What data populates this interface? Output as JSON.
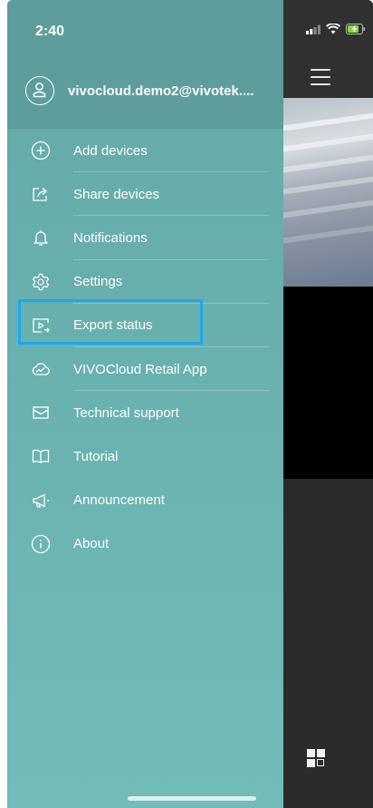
{
  "status_bar": {
    "time": "2:40"
  },
  "account": {
    "email": "vivocloud.demo2@vivotek...."
  },
  "menu": {
    "items": [
      {
        "label": "Add devices",
        "icon": "plus-circle-icon"
      },
      {
        "label": "Share devices",
        "icon": "share-icon"
      },
      {
        "label": "Notifications",
        "icon": "bell-icon"
      },
      {
        "label": "Settings",
        "icon": "gear-icon"
      },
      {
        "label": "Export status",
        "icon": "export-video-icon"
      },
      {
        "label": "VIVOCloud Retail App",
        "icon": "cloud-chart-icon"
      },
      {
        "label": "Technical support",
        "icon": "mail-icon"
      },
      {
        "label": "Tutorial",
        "icon": "book-icon"
      },
      {
        "label": "Announcement",
        "icon": "megaphone-icon"
      },
      {
        "label": "About",
        "icon": "info-icon"
      }
    ]
  },
  "colors": {
    "drawer": "#68b0ae",
    "highlight": "#1aa9f0",
    "battery": "#7ddc3a"
  }
}
